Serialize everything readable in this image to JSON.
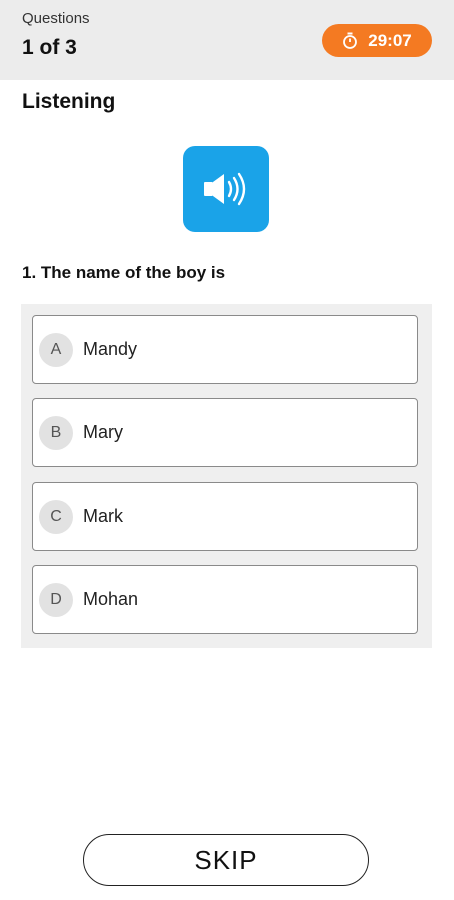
{
  "header": {
    "label": "Questions",
    "progress": "1 of 3",
    "timer": "29:07",
    "timer_icon": "stopwatch-icon",
    "timer_color": "#f47a22"
  },
  "section": {
    "title": "Listening",
    "audio_icon": "speaker-icon",
    "audio_color": "#1aa3e8"
  },
  "question": {
    "text": "1. The name of the boy is",
    "options": [
      {
        "letter": "A",
        "text": "Mandy"
      },
      {
        "letter": "B",
        "text": "Mary"
      },
      {
        "letter": "C",
        "text": "Mark"
      },
      {
        "letter": "D",
        "text": "Mohan"
      }
    ]
  },
  "footer": {
    "skip_label": "SKIP"
  }
}
